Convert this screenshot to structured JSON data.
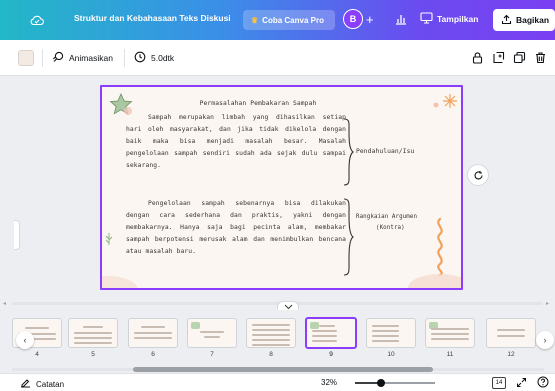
{
  "header": {
    "doc_title": "Struktur dan Kebahasaan Teks Diskusi",
    "pro_label": "Coba Canva Pro",
    "avatar_initial": "B",
    "present_label": "Tampilkan",
    "share_label": "Bagikan"
  },
  "toolbar": {
    "animate_label": "Animasikan",
    "duration_label": "5.0dtk"
  },
  "slide": {
    "title": "Permasalahan Pembakaran Sampah",
    "paragraph1": "Sampah merupakan limbah yang dihasilkan setiap hari oleh masyarakat, dan jika tidak dikelola dengan baik maka bisa menjadi masalah besar. Masalah pengelolaan sampah sendiri sudah ada sejak dulu sampai sekarang.",
    "paragraph2": "Pengelolaan sampah sebenarnya bisa dilakukan dengan cara sederhana dan praktis, yakni dengan membakarnya. Hanya saja bagi pecinta alam, membakar sampah berpotensi merusak alam dan menimbulkan bencana atau masalah baru.",
    "label1": "Pendahuluan/Isu",
    "label2_line1": "Rangkaian Argumen",
    "label2_line2": "(Kontra)"
  },
  "filmstrip": {
    "pages": [
      {
        "num": "4"
      },
      {
        "num": "5"
      },
      {
        "num": "6"
      },
      {
        "num": "7"
      },
      {
        "num": "8"
      },
      {
        "num": "9"
      },
      {
        "num": "10"
      },
      {
        "num": "11"
      },
      {
        "num": "12"
      }
    ],
    "active_page": "9"
  },
  "bottombar": {
    "notes_label": "Catatan",
    "zoom": "32%",
    "zoom_fraction": 0.32,
    "page_count_badge": "14"
  },
  "colors": {
    "accent": "#8b3dff",
    "slide_bg": "#fbf6f2"
  }
}
